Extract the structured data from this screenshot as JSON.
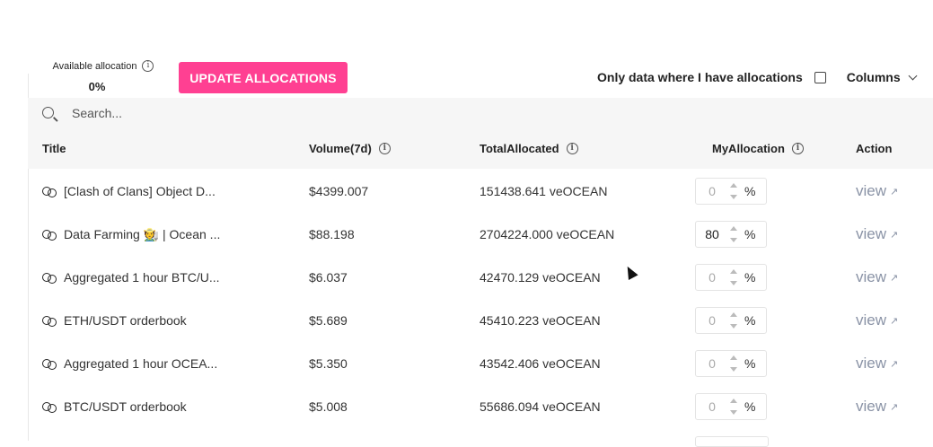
{
  "available_allocation": {
    "label": "Available allocation",
    "value": "0%"
  },
  "update_button": "UPDATE ALLOCATIONS",
  "filter": {
    "label": "Only data where I have allocations",
    "checked": false
  },
  "columns_button": "Columns",
  "search": {
    "placeholder": "Search..."
  },
  "table": {
    "headers": {
      "title": "Title",
      "volume": "Volume(7d)",
      "total_allocated": "TotalAllocated",
      "my_allocation": "MyAllocation",
      "action": "Action"
    },
    "rows": [
      {
        "title": "[Clash of Clans] Object D...",
        "volume": "$4399.007",
        "total_allocated": "151438.641 veOCEAN",
        "my_allocation": "0",
        "percent": "%",
        "action": "view"
      },
      {
        "title": "Data Farming 🧑‍🌾 | Ocean ...",
        "volume": "$88.198",
        "total_allocated": "2704224.000 veOCEAN",
        "my_allocation": "80",
        "percent": "%",
        "action": "view"
      },
      {
        "title": "Aggregated 1 hour BTC/U...",
        "volume": "$6.037",
        "total_allocated": "42470.129 veOCEAN",
        "my_allocation": "0",
        "percent": "%",
        "action": "view"
      },
      {
        "title": "ETH/USDT orderbook",
        "volume": "$5.689",
        "total_allocated": "45410.223 veOCEAN",
        "my_allocation": "0",
        "percent": "%",
        "action": "view"
      },
      {
        "title": "Aggregated 1 hour OCEA...",
        "volume": "$5.350",
        "total_allocated": "43542.406 veOCEAN",
        "my_allocation": "0",
        "percent": "%",
        "action": "view"
      },
      {
        "title": "BTC/USDT orderbook",
        "volume": "$5.008",
        "total_allocated": "55686.094 veOCEAN",
        "my_allocation": "0",
        "percent": "%",
        "action": "view"
      }
    ]
  },
  "colors": {
    "accent": "#ff4092",
    "link": "#8a93a6",
    "header_bg": "#f6f6f6"
  },
  "icons": [
    "info-icon",
    "search-icon",
    "chevron-down-icon",
    "link-icon",
    "external-arrow-icon",
    "checkbox-icon"
  ]
}
